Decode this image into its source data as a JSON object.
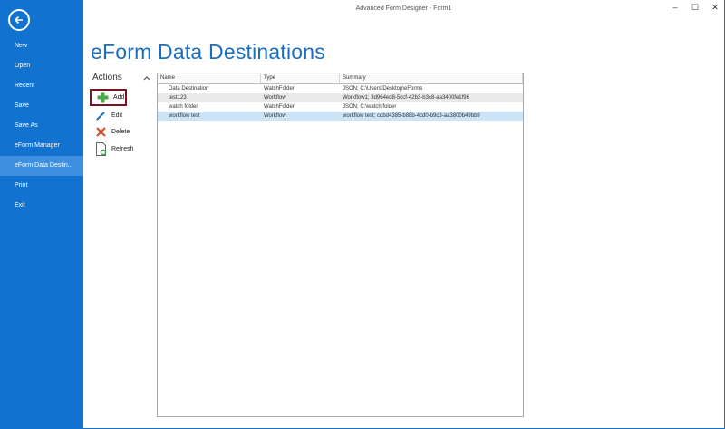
{
  "app": {
    "title": "Advanced Form Designer - Form1"
  },
  "window_controls": {
    "minimize": "–",
    "maximize": "☐",
    "close": "✕"
  },
  "sidebar": {
    "items": [
      {
        "label": "New"
      },
      {
        "label": "Open"
      },
      {
        "label": "Recent"
      },
      {
        "label": "Save"
      },
      {
        "label": "Save As"
      },
      {
        "label": "eForm Manager"
      },
      {
        "label": "eForm Data Destin..."
      },
      {
        "label": "Print"
      },
      {
        "label": "Exit"
      }
    ],
    "active_index": 6
  },
  "page": {
    "title": "eForm Data Destinations"
  },
  "actions": {
    "header": "Actions",
    "items": [
      {
        "label": "Add",
        "icon": "plus-icon"
      },
      {
        "label": "Edit",
        "icon": "pencil-icon"
      },
      {
        "label": "Delete",
        "icon": "x-delete-icon"
      },
      {
        "label": "Refresh",
        "icon": "refresh-doc-icon"
      }
    ]
  },
  "table": {
    "columns": [
      "Name",
      "Type",
      "Summary"
    ],
    "rows": [
      {
        "name": "Data Destination",
        "type": "WatchFolder",
        "summary": "JSON;  C:\\Users\\Desktop\\eForms"
      },
      {
        "name": "test123",
        "type": "Workflow",
        "summary": "Workflow1;  3d964ed8-5ccf-42b3-b3c8-aa3400fe1f96"
      },
      {
        "name": "watch folder",
        "type": "WatchFolder",
        "summary": "JSON;  C:\\watch folder"
      },
      {
        "name": "workflow test",
        "type": "Workflow",
        "summary": "workflow test;  cdbd4385-b88b-4cd0-b9c3-aa3800b49bb9"
      }
    ],
    "selected_row": 3
  },
  "colors": {
    "sidebar": "#1173cf",
    "title": "#1a6fc2",
    "highlight_border": "#7a1320",
    "selected_row": "#cde4f7"
  }
}
